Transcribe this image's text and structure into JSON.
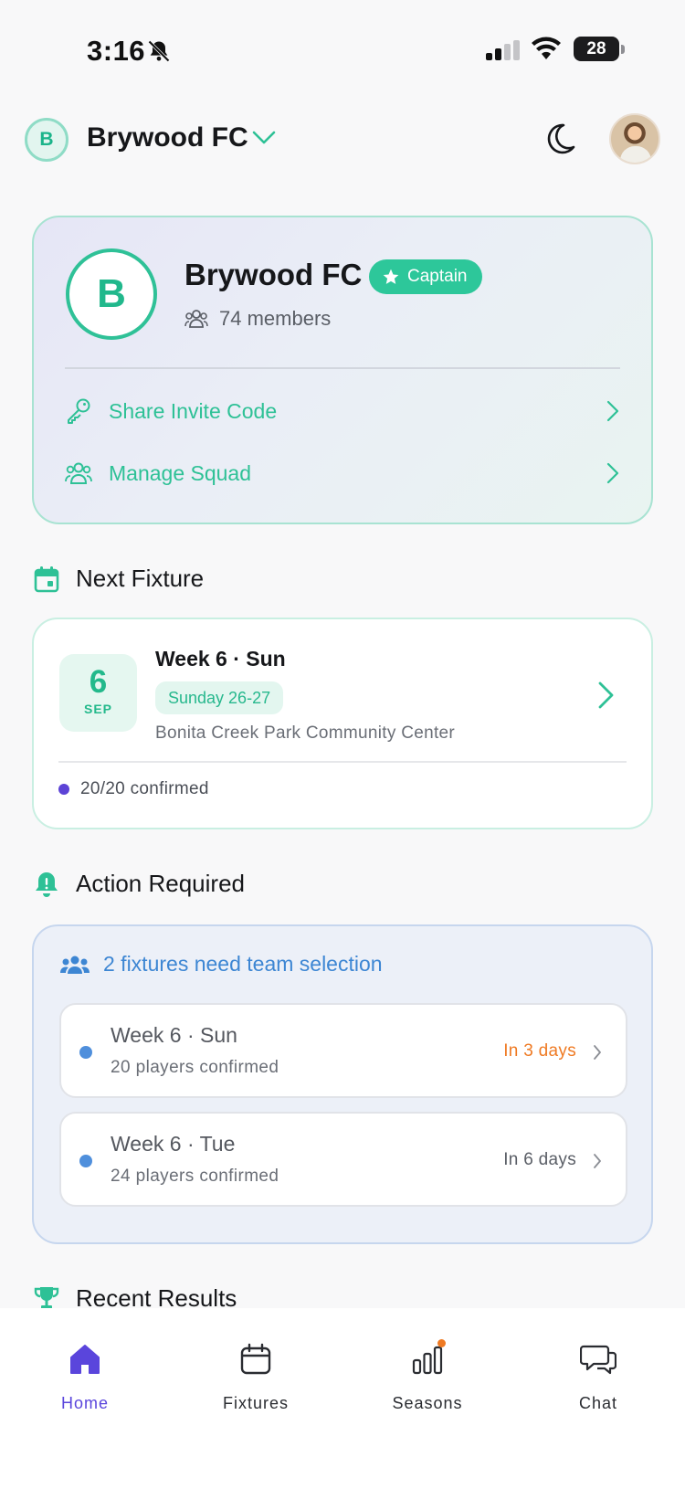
{
  "status_bar": {
    "time": "3:16",
    "battery": "28"
  },
  "header": {
    "team_initial": "B",
    "team_name": "Brywood FC"
  },
  "team_card": {
    "initial": "B",
    "name": "Brywood FC",
    "role_badge": "Captain",
    "members": "74 members",
    "actions": [
      {
        "label": "Share Invite Code",
        "icon": "key-icon"
      },
      {
        "label": "Manage Squad",
        "icon": "people-icon"
      }
    ]
  },
  "next_fixture": {
    "heading": "Next Fixture",
    "day": "6",
    "month": "SEP",
    "title": "Week 6 · Sun",
    "date_label": "Sunday 26-27",
    "venue": "Bonita Creek Park Community Center",
    "confirmed": "20/20 confirmed"
  },
  "action_required": {
    "heading": "Action Required",
    "summary": "2 fixtures need team selection",
    "items": [
      {
        "title": "Week 6 · Sun",
        "subtitle": "20 players confirmed",
        "when": "In 3 days"
      },
      {
        "title": "Week 6 · Tue",
        "subtitle": "24 players confirmed",
        "when": "In 6 days"
      }
    ]
  },
  "recent_results": {
    "heading": "Recent Results"
  },
  "tabs": [
    {
      "label": "Home",
      "icon": "home-icon",
      "active": true
    },
    {
      "label": "Fixtures",
      "icon": "calendar-icon",
      "active": false
    },
    {
      "label": "Seasons",
      "icon": "bar-chart-icon",
      "active": false
    },
    {
      "label": "Chat",
      "icon": "chat-icon",
      "active": false
    }
  ],
  "colors": {
    "accent_green": "#2dc79a",
    "accent_purple": "#5a45dc",
    "info_blue": "#3d86d3",
    "warning_orange": "#ef7a23"
  }
}
